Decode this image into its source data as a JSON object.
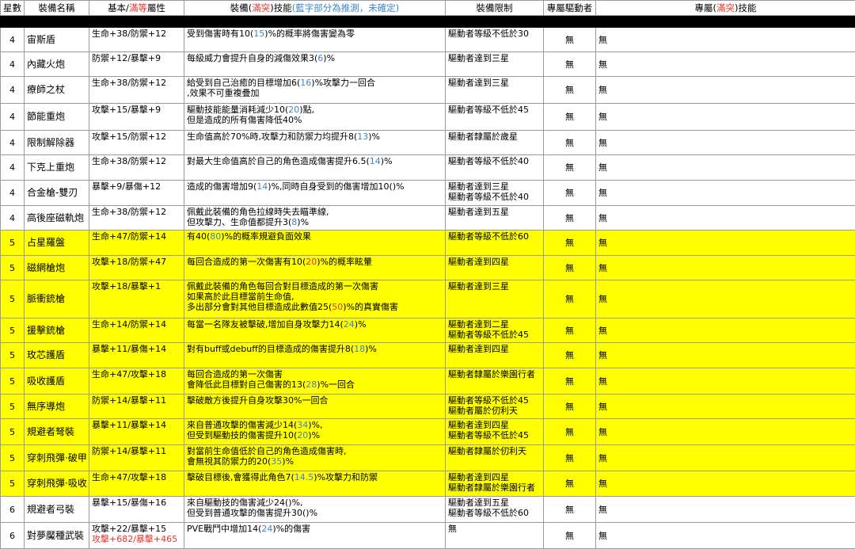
{
  "header": {
    "star": "星數",
    "name": "裝備名稱",
    "stat_a": "基本/",
    "stat_red": "滿等",
    "stat_b": "屬性",
    "skill_a": "裝備(",
    "skill_red": "滿突",
    "skill_b": ")技能",
    "skill_note": "(藍字部分為推測，未確定)",
    "limit": "裝備限制",
    "driver": "專屬驅動者",
    "ex_a": "專屬(",
    "ex_red": "滿突",
    "ex_b": ")技能"
  },
  "colors": {
    "highlight": "#ffff00",
    "red": "#e8332a",
    "blue": "#3d85c6"
  },
  "rows": [
    {
      "star": "4",
      "name": "宙斯盾",
      "stat": "生命+38/防禦+12",
      "skill": [
        [
          "受到傷害時有10(",
          "15",
          ")%的概率將傷害變為零"
        ]
      ],
      "limit": [
        "驅動者等級不低於30"
      ],
      "driver": "無",
      "ex": "無"
    },
    {
      "star": "4",
      "name": "內藏火炮",
      "stat": "防禦+12/暴擊+9",
      "skill": [
        [
          "每級威力會提升自身的減傷效果3(",
          "6",
          ")%"
        ]
      ],
      "limit": [
        "驅動者達到三星"
      ],
      "driver": "無",
      "ex": "無"
    },
    {
      "star": "4",
      "name": "療師之杖",
      "stat": "生命+38/防禦+12",
      "skill": [
        [
          "給受到自己治癒的目標增加6(",
          "16",
          ")%攻擊力一回合"
        ],
        [
          ",效果不可重複疊加",
          "",
          ""
        ]
      ],
      "limit": [
        "驅動者達到三星"
      ],
      "driver": "無",
      "ex": "無"
    },
    {
      "star": "4",
      "name": "節能重炮",
      "stat": "攻擊+15/暴擊+9",
      "skill": [
        [
          "驅動技能能量消耗減少10(",
          "20",
          ")點,"
        ],
        [
          "但是造成的所有傷害降低40%",
          "",
          ""
        ]
      ],
      "limit": [
        "驅動者等級不低於45"
      ],
      "driver": "無",
      "ex": "無"
    },
    {
      "star": "4",
      "name": "限制解除器",
      "stat": "攻擊+15/防禦+12",
      "skill": [
        [
          "生命值高於70%時,攻擊力和防禦力均提升8(",
          "13",
          ")%"
        ]
      ],
      "limit": [
        "驅動者隸屬於歲星"
      ],
      "driver": "無",
      "ex": "無"
    },
    {
      "star": "4",
      "name": "下克上重炮",
      "stat": "生命+38/防禦+12",
      "skill": [
        [
          "對最大生命值高於自己的角色造成傷害提升6.5(",
          "14",
          ")%"
        ]
      ],
      "limit": [
        "驅動者等級不低於40"
      ],
      "driver": "無",
      "ex": "無"
    },
    {
      "star": "4",
      "name": "合金槍-雙刃",
      "stat": "暴擊+9/暴傷+12",
      "skill": [
        [
          "造成的傷害增加9(",
          "14",
          ")%,同時自身受到的傷害增加10()%"
        ]
      ],
      "limit": [
        "驅動者達到三星",
        "驅動者等級不低於40"
      ],
      "driver": "無",
      "ex": "無"
    },
    {
      "star": "4",
      "name": "高後座磁軌炮",
      "stat": "生命+38/防禦+12",
      "skill": [
        [
          "佩戴此裝備的角色拉線時失去瞄準線,",
          "",
          ""
        ],
        [
          "但攻擊力、生命值都提升3(",
          "8",
          ")%"
        ]
      ],
      "limit": [
        "驅動者達到五星"
      ],
      "driver": "無",
      "ex": "無"
    },
    {
      "star": "5",
      "name": "占星羅盤",
      "stat": "生命+47/防禦+14",
      "skill": [
        [
          "有40(",
          "80",
          ")%的概率規避負面效果"
        ]
      ],
      "limit": [
        "驅動者等級不低於60"
      ],
      "driver": "無",
      "ex": "無",
      "hl": true
    },
    {
      "star": "5",
      "name": "磁網槍炮",
      "stat": "攻擊+18/防禦+47",
      "skill": [
        [
          "每回合造成的第一次傷害有10(",
          "20",
          ")%的概率眩暈"
        ]
      ],
      "limit": [
        "驅動者達到四星"
      ],
      "driver": "無",
      "ex": "無",
      "hl": true,
      "skillRed": true
    },
    {
      "star": "5",
      "name": "脈衝銃槍",
      "stat": "攻擊+18/暴擊+1",
      "skill": [
        [
          "佩戴此裝備的角色每回合對目標造成的第一次傷害",
          "",
          ""
        ],
        [
          "如果高於此目標當前生命值,",
          "",
          ""
        ],
        [
          "多出部分會對其他目標造成此數值25(",
          "50",
          ")%的真實傷害"
        ]
      ],
      "limit": [
        "驅動者達到三星"
      ],
      "driver": "無",
      "ex": "無",
      "hl": true,
      "skillRed": true
    },
    {
      "star": "5",
      "name": "援擊銃槍",
      "stat": "生命+14/防禦+14",
      "skill": [
        [
          "每當一名隊友被擊破,增加自身攻擊力14(",
          "24",
          ")%"
        ]
      ],
      "limit": [
        "驅動者達到二星",
        "驅動者等級不低於45"
      ],
      "driver": "無",
      "ex": "無",
      "hl": true
    },
    {
      "star": "5",
      "name": "玫芯護盾",
      "stat": "暴擊+11/暴傷+14",
      "skill": [
        [
          "對有buff或debuff的目標造成的傷害提升8(",
          "18",
          ")%"
        ]
      ],
      "limit": [
        "驅動者達到四星"
      ],
      "driver": "無",
      "ex": "無",
      "hl": true
    },
    {
      "star": "5",
      "name": "吸收護盾",
      "stat": "生命+47/攻擊+18",
      "skill": [
        [
          "每回合造成的第一次傷害",
          "",
          ""
        ],
        [
          "會降低此目標對自己傷害的13(",
          "28",
          ")%一回合"
        ]
      ],
      "limit": [
        "驅動者隸屬於樂園行者"
      ],
      "driver": "無",
      "ex": "無",
      "hl": true
    },
    {
      "star": "5",
      "name": "無序導炮",
      "stat": "防禦+14/暴擊+11",
      "skill": [
        [
          "擊破敵方後提升自身攻擊30%一回合",
          "",
          ""
        ]
      ],
      "limit": [
        "驅動者等級不低於45",
        "驅動者屬於仞利天"
      ],
      "driver": "無",
      "ex": "無",
      "hl": true
    },
    {
      "star": "5",
      "name": "規避者弩裝",
      "stat": "暴擊+11/暴擊+14",
      "skill": [
        [
          "來自普通攻擊的傷害減少14(",
          "34",
          ")%,"
        ],
        [
          "但受到驅動技的傷害提升10(",
          "20",
          ")%"
        ]
      ],
      "limit": [
        "驅動者達到四星",
        "驅動者等級不低於45"
      ],
      "driver": "無",
      "ex": "無",
      "hl": true
    },
    {
      "star": "5",
      "name": "穿刺飛彈·破甲",
      "stat": "防禦+14/暴擊+11",
      "skill": [
        [
          "對當前生命值低於自己的角色造成傷害時,",
          "",
          ""
        ],
        [
          "會無視其防禦力的20(",
          "35",
          ")%"
        ]
      ],
      "limit": [
        "驅動者隸屬於仞利天"
      ],
      "driver": "無",
      "ex": "無",
      "hl": true
    },
    {
      "star": "5",
      "name": "穿刺飛彈·吸收",
      "stat": "生命+47/攻擊+18",
      "skill": [
        [
          "擊破目標後,會獲得此角色7(",
          "14.5",
          ")%攻擊力和防禦"
        ]
      ],
      "limit": [
        "驅動者達到四星",
        "驅動者隸屬於樂園行者"
      ],
      "driver": "無",
      "ex": "無",
      "hl": true
    },
    {
      "star": "6",
      "name": "規避者弓裝",
      "stat": "暴擊+15/暴傷+16",
      "skill": [
        [
          "來自驅動技的傷害減少24()%,",
          "",
          ""
        ],
        [
          "但受到普通攻擊的傷害提升30()%",
          "",
          ""
        ]
      ],
      "limit": [
        "驅動者達到五星",
        "驅動者等級不低於60"
      ],
      "driver": "無",
      "ex": "無"
    },
    {
      "star": "6",
      "name": "對夢魘種武裝",
      "stat": "攻擊+22/暴擊+15",
      "stat2": "攻擊+682/暴擊+465",
      "skill": [
        [
          "PVE戰鬥中增加14(",
          "24",
          ")%的傷害"
        ]
      ],
      "limit": [
        "無"
      ],
      "driver": "無",
      "ex": "無"
    }
  ]
}
